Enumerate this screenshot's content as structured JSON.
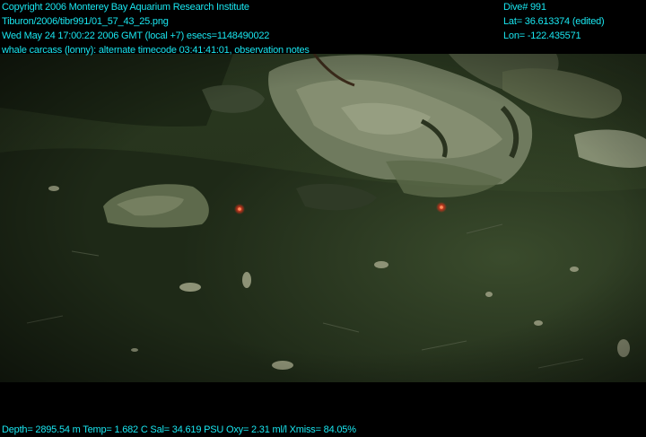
{
  "overlay": {
    "top_left": [
      "Copyright 2006 Monterey Bay Aquarium Research Institute",
      "Tiburon/2006/tibr991/01_57_43_25.png",
      "Wed May 24 17:00:22 2006 GMT (local +7)  esecs=1148490022",
      "whale carcass (lonny): alternate timecode 03:41:41:01, observation notes"
    ],
    "top_right": [
      "Dive# 991",
      "Lat= 36.613374 (edited)",
      "Lon= -122.435571"
    ],
    "bottom": "Depth= 2895.54 m  Temp= 1.682 C  Sal= 34.619 PSU  Oxy= 2.31 ml/l  Xmiss= 84.05%"
  },
  "colors": {
    "overlay_text": "#19e6f0",
    "water": "#2b3a22",
    "sediment": "#1b2515",
    "bone": "#8c9478",
    "laser": "#ff3a1a"
  }
}
